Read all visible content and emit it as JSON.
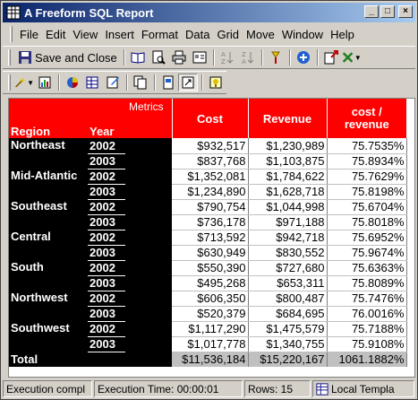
{
  "window": {
    "title": "A Freeform SQL Report"
  },
  "menu": [
    "File",
    "Edit",
    "View",
    "Insert",
    "Format",
    "Data",
    "Grid",
    "Move",
    "Window",
    "Help"
  ],
  "toolbar": {
    "save_close_label": "Save and Close"
  },
  "grid": {
    "headers": {
      "metrics": "Metrics",
      "region": "Region",
      "year": "Year",
      "cost": "Cost",
      "revenue": "Revenue",
      "ratio": "cost / revenue"
    },
    "regions": [
      {
        "name": "Northeast",
        "rows": [
          {
            "year": "2002",
            "cost": "$932,517",
            "revenue": "$1,230,989",
            "ratio": "75.7535%"
          },
          {
            "year": "2003",
            "cost": "$837,768",
            "revenue": "$1,103,875",
            "ratio": "75.8934%"
          }
        ]
      },
      {
        "name": "Mid-Atlantic",
        "rows": [
          {
            "year": "2002",
            "cost": "$1,352,081",
            "revenue": "$1,784,622",
            "ratio": "75.7629%"
          },
          {
            "year": "2003",
            "cost": "$1,234,890",
            "revenue": "$1,628,718",
            "ratio": "75.8198%"
          }
        ]
      },
      {
        "name": "Southeast",
        "rows": [
          {
            "year": "2002",
            "cost": "$790,754",
            "revenue": "$1,044,998",
            "ratio": "75.6704%"
          },
          {
            "year": "2003",
            "cost": "$736,178",
            "revenue": "$971,188",
            "ratio": "75.8018%"
          }
        ]
      },
      {
        "name": "Central",
        "rows": [
          {
            "year": "2002",
            "cost": "$713,592",
            "revenue": "$942,718",
            "ratio": "75.6952%"
          },
          {
            "year": "2003",
            "cost": "$630,949",
            "revenue": "$830,552",
            "ratio": "75.9674%"
          }
        ]
      },
      {
        "name": "South",
        "rows": [
          {
            "year": "2002",
            "cost": "$550,390",
            "revenue": "$727,680",
            "ratio": "75.6363%"
          },
          {
            "year": "2003",
            "cost": "$495,268",
            "revenue": "$653,311",
            "ratio": "75.8089%"
          }
        ]
      },
      {
        "name": "Northwest",
        "rows": [
          {
            "year": "2002",
            "cost": "$606,350",
            "revenue": "$800,487",
            "ratio": "75.7476%"
          },
          {
            "year": "2003",
            "cost": "$520,379",
            "revenue": "$684,695",
            "ratio": "76.0016%"
          }
        ]
      },
      {
        "name": "Southwest",
        "rows": [
          {
            "year": "2002",
            "cost": "$1,117,290",
            "revenue": "$1,475,579",
            "ratio": "75.7188%"
          },
          {
            "year": "2003",
            "cost": "$1,017,778",
            "revenue": "$1,340,755",
            "ratio": "75.9108%"
          }
        ]
      }
    ],
    "total": {
      "label": "Total",
      "cost": "$11,536,184",
      "revenue": "$15,220,167",
      "ratio": "1061.1882%"
    }
  },
  "status": {
    "execution": "Execution compl",
    "time": "Execution Time: 00:00:01",
    "rows": "Rows: 15",
    "template": "Local Templa"
  },
  "colors": {
    "header_red": "#ff0000",
    "row_header_black": "#000000",
    "title_blue": "#0a246a"
  },
  "icons": [
    "grid-app-icon",
    "save-icon",
    "book-icon",
    "print-preview-icon",
    "print-icon",
    "properties-icon",
    "sort-ascending-icon",
    "sort-descending-icon",
    "drill-icon",
    "navigate-icon",
    "export-icon",
    "excel-icon",
    "wand-icon",
    "data-icon",
    "chart-icon",
    "grid-view-icon",
    "sql-view-icon",
    "copy-icon",
    "page-icon",
    "subtotal-icon",
    "note-icon"
  ]
}
